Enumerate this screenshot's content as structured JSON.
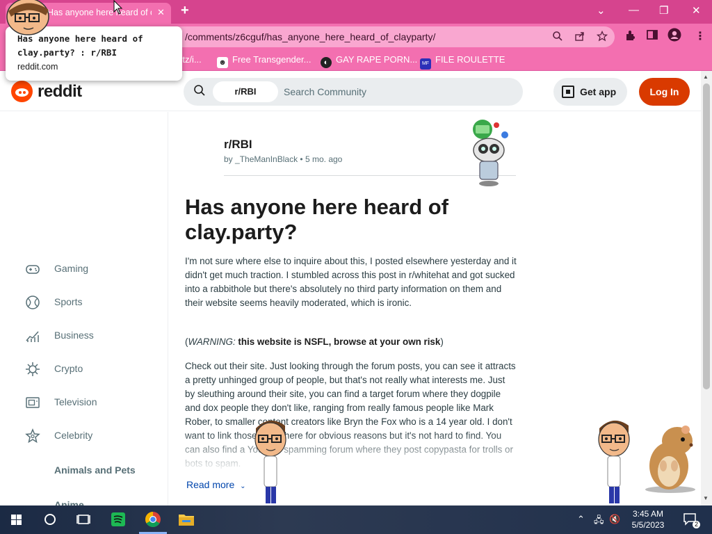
{
  "browser": {
    "tab_title": "Has anyone here heard of clay.party? : r/RBI",
    "tab_close": "✕",
    "new_tab": "+",
    "url": "/comments/z6cguf/has_anyone_here_heard_of_clayparty/",
    "window_controls": {
      "dropdown": "⌄",
      "minimize": "—",
      "restore": "❐",
      "close": "✕"
    },
    "bookmarks": [
      {
        "label": "rtz/i...",
        "icon": "partial-bookmark-icon"
      },
      {
        "label": "Free Transgender...",
        "icon": "bookmark-favicon-icon"
      },
      {
        "label": "GAY RAPE PORN...",
        "icon": "bookmark-favicon-icon"
      },
      {
        "label": "FILE ROULETTE",
        "icon": "bookmark-favicon-icon"
      }
    ]
  },
  "tooltip": {
    "title": "Has anyone here heard of clay.party? : r/RBI",
    "domain": "reddit.com"
  },
  "reddit": {
    "wordmark": "reddit",
    "search_chip": "r/RBI",
    "search_placeholder": "Search Community",
    "get_app": "Get app",
    "login": "Log In",
    "brand_color": "#ff4500",
    "login_color": "#d93a00"
  },
  "sidebar": {
    "items": [
      {
        "label": "Gaming",
        "icon": "gamepad-icon"
      },
      {
        "label": "Sports",
        "icon": "ball-icon"
      },
      {
        "label": "Business",
        "icon": "chart-icon"
      },
      {
        "label": "Crypto",
        "icon": "crypto-icon"
      },
      {
        "label": "Television",
        "icon": "tv-icon"
      },
      {
        "label": "Celebrity",
        "icon": "star-icon"
      }
    ],
    "section_header": "Animals and Pets",
    "partial_item": "Anime"
  },
  "post": {
    "subreddit": "r/RBI",
    "by": "by",
    "author": "_TheManInBlack",
    "separator": "•",
    "age": "5 mo. ago",
    "title": "Has anyone here heard of clay.party?",
    "p1_before_link": "I'm not sure where else to inquire about this, I posted elsewhere yesterday and it didn't get much traction. I stumbled across this post in ",
    "p1_link": "r/whitehat",
    "p1_after_link": " and got sucked into a rabbithole but there's absolutely no third party information on them and their website seems heavily moderated, which is ironic.",
    "warn_open": "(",
    "warn_label": "WARNING:",
    "warn_text": " this website is NSFL, browse at your own risk",
    "warn_close": ")",
    "p3_before_link": "Check out their site. Just looking through the forum posts, you can see it attracts a pretty unhinged group of people, but that's not really what interests me. Just by sleuthing around their site, you can find a ",
    "p3_link": "target forum",
    "p3_after_link": " where they dogpile and dox people they don't like, ranging from really famous people like Mark Rober, to smaller content creators like Bryn the Fox who is a 14 year old. I don't want to link those posts here for obvious reasons but it's not hard to find. You can also find a Youtube spamming forum where they post copypasta for trolls or bots to spam.",
    "read_more": "Read more"
  },
  "taskbar": {
    "time": "3:45 AM",
    "date": "5/5/2023",
    "notification_count": "2"
  }
}
